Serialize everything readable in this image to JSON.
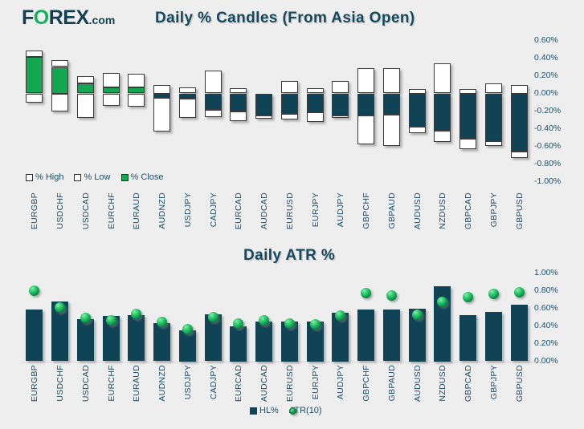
{
  "brand": {
    "pre": "F",
    "o": "O",
    "post": "REX",
    "suffix": ".com",
    "color": "#12b35c"
  },
  "colors": {
    "background": "#eeeeee",
    "text": "#1d4e63",
    "title": "#15485c",
    "close_up": "#12a852",
    "close_down": "#114357",
    "wick": "#ffffff",
    "atr_marker": "#12a852"
  },
  "charts": {
    "top": {
      "title": "Daily % Candles (From Asia Open)",
      "legend": [
        {
          "label": "% High",
          "style": "white"
        },
        {
          "label": "% Low",
          "style": "white"
        },
        {
          "label": "% Close",
          "style": "green"
        }
      ]
    },
    "bottom": {
      "title": "Daily ATR %",
      "legend": [
        {
          "label": "HL%",
          "style": "navy"
        },
        {
          "label": "ATR(10)",
          "style": "dot"
        }
      ]
    }
  },
  "chart_data": [
    {
      "type": "bar",
      "subtype": "candlestick-stacked",
      "title": "Daily % Candles (From Asia Open)",
      "xlabel": "",
      "ylabel": "",
      "ylim": [
        -1.0,
        0.6
      ],
      "yticks": [
        0.6,
        0.4,
        0.2,
        0.0,
        -0.2,
        -0.4,
        -0.6,
        -0.8,
        -1.0
      ],
      "ytick_labels": [
        "0.60%",
        "0.40%",
        "0.20%",
        "0.00%",
        "-0.20%",
        "-0.40%",
        "-0.60%",
        "-0.80%",
        "-1.00%"
      ],
      "grid": false,
      "legend": [
        "% High",
        "% Low",
        "% Close"
      ],
      "legend_position": "bottom-left",
      "categories": [
        "EURGBP",
        "USDCHF",
        "USDCAD",
        "EURCHF",
        "EURAUD",
        "AUDNZD",
        "USDJPY",
        "CADJPY",
        "EURCAD",
        "AUDCAD",
        "EURUSD",
        "EURJPY",
        "AUDJPY",
        "GBPCHF",
        "GBPAUD",
        "AUDUSD",
        "NZDUSD",
        "GBPCAD",
        "GBPJPY",
        "GBPUSD"
      ],
      "series": [
        {
          "name": "% High",
          "values": [
            0.49,
            0.38,
            0.2,
            0.23,
            0.22,
            0.1,
            0.07,
            0.26,
            0.06,
            0.0,
            0.14,
            0.06,
            0.14,
            0.29,
            0.29,
            0.05,
            0.34,
            0.05,
            0.11,
            0.1
          ]
        },
        {
          "name": "% Close",
          "values": [
            0.41,
            0.3,
            0.11,
            0.07,
            0.07,
            -0.05,
            -0.06,
            -0.19,
            -0.2,
            -0.25,
            -0.23,
            -0.21,
            -0.25,
            -0.25,
            -0.24,
            -0.38,
            -0.42,
            -0.51,
            -0.54,
            -0.66
          ]
        },
        {
          "name": "% Low",
          "values": [
            -0.1,
            -0.2,
            -0.28,
            -0.14,
            -0.15,
            -0.43,
            -0.28,
            -0.27,
            -0.31,
            -0.29,
            -0.3,
            -0.32,
            -0.28,
            -0.58,
            -0.6,
            -0.45,
            -0.55,
            -0.63,
            -0.6,
            -0.73
          ]
        }
      ]
    },
    {
      "type": "bar",
      "subtype": "bar-with-markers",
      "title": "Daily ATR %",
      "xlabel": "",
      "ylabel": "",
      "ylim": [
        0.0,
        1.0
      ],
      "yticks": [
        1.0,
        0.8,
        0.6,
        0.4,
        0.2,
        0.0
      ],
      "ytick_labels": [
        "1.00%",
        "0.80%",
        "0.60%",
        "0.40%",
        "0.20%",
        "0.00%"
      ],
      "grid": false,
      "legend": [
        "HL%",
        "ATR(10)"
      ],
      "legend_position": "bottom-center",
      "categories": [
        "EURGBP",
        "USDCHF",
        "USDCAD",
        "EURCHF",
        "EURAUD",
        "AUDNZD",
        "USDJPY",
        "CADJPY",
        "EURCAD",
        "AUDCAD",
        "EURUSD",
        "EURJPY",
        "AUDJPY",
        "GBPCHF",
        "GBPAUD",
        "AUDUSD",
        "NZDUSD",
        "GBPCAD",
        "GBPJPY",
        "GBPUSD"
      ],
      "series": [
        {
          "name": "HL%",
          "type": "bar",
          "values": [
            0.59,
            0.68,
            0.48,
            0.51,
            0.52,
            0.43,
            0.35,
            0.53,
            0.4,
            0.45,
            0.45,
            0.45,
            0.55,
            0.59,
            0.59,
            0.6,
            0.85,
            0.52,
            0.56,
            0.64
          ]
        },
        {
          "name": "ATR(10)",
          "type": "marker",
          "values": [
            0.8,
            0.61,
            0.49,
            0.46,
            0.54,
            0.45,
            0.36,
            0.5,
            0.43,
            0.46,
            0.43,
            0.42,
            0.52,
            0.77,
            0.75,
            0.53,
            0.67,
            0.73,
            0.76,
            0.78
          ]
        }
      ]
    }
  ]
}
